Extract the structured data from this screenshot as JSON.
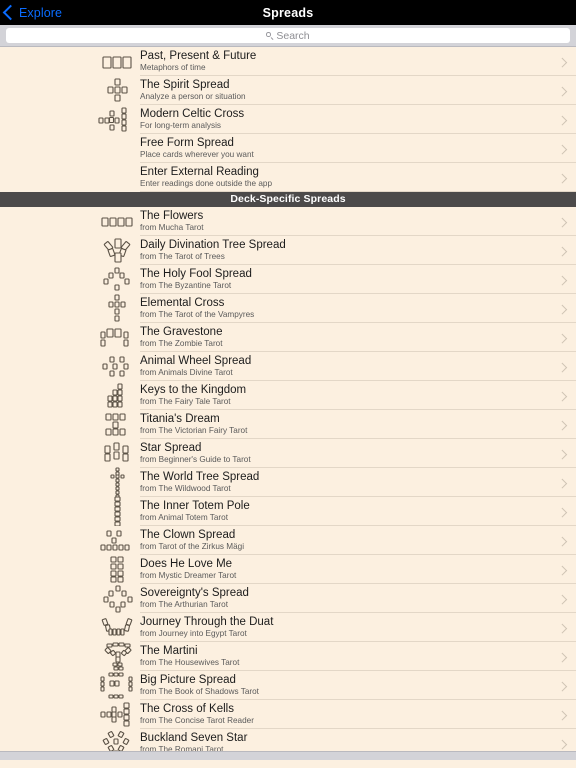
{
  "navbar": {
    "back_label": "Explore",
    "back_icon": "chevron-left-icon",
    "title": "Spreads"
  },
  "search": {
    "placeholder": "Search",
    "value": "",
    "icon": "search-icon"
  },
  "sections": [
    {
      "header": null,
      "rows": [
        {
          "title": "Past, Present & Future",
          "subtitle": "Metaphors of time",
          "icon": "three-cards-row-icon"
        },
        {
          "title": "The Spirit Spread",
          "subtitle": "Analyze a person or situation",
          "icon": "spirit-cross-icon"
        },
        {
          "title": "Modern Celtic Cross",
          "subtitle": "For long-term analysis",
          "icon": "celtic-cross-icon"
        },
        {
          "title": "Free Form Spread",
          "subtitle": "Place cards wherever you want",
          "icon": "none"
        },
        {
          "title": "Enter External Reading",
          "subtitle": "Enter readings done outside the app",
          "icon": "none"
        }
      ]
    },
    {
      "header": "Deck-Specific Spreads",
      "rows": [
        {
          "title": "The Flowers",
          "subtitle": "from Mucha Tarot",
          "icon": "four-cards-row-icon"
        },
        {
          "title": "Daily Divination Tree Spread",
          "subtitle": "from The Tarot of Trees",
          "icon": "tree-fan-icon"
        },
        {
          "title": "The Holy Fool Spread",
          "subtitle": "from The Byzantine Tarot",
          "icon": "holy-fool-icon"
        },
        {
          "title": "Elemental Cross",
          "subtitle": "from The Tarot of the Vampyres",
          "icon": "elemental-cross-icon"
        },
        {
          "title": "The Gravestone",
          "subtitle": "from The Zombie Tarot",
          "icon": "gravestone-icon"
        },
        {
          "title": "Animal Wheel Spread",
          "subtitle": "from Animals Divine Tarot",
          "icon": "animal-wheel-icon"
        },
        {
          "title": "Keys to the Kingdom",
          "subtitle": "from The Fairy Tale Tarot",
          "icon": "keys-kingdom-icon"
        },
        {
          "title": "Titania's Dream",
          "subtitle": "from The Victorian Fairy Tarot",
          "icon": "titania-dream-icon"
        },
        {
          "title": "Star Spread",
          "subtitle": "from Beginner's Guide to Tarot",
          "icon": "star-spread-icon"
        },
        {
          "title": "The World Tree Spread",
          "subtitle": "from The Wildwood Tarot",
          "icon": "world-tree-icon"
        },
        {
          "title": "The Inner Totem Pole",
          "subtitle": "from Animal Totem Tarot",
          "icon": "totem-pole-icon"
        },
        {
          "title": "The Clown Spread",
          "subtitle": "from Tarot of the Zirkus Mägi",
          "icon": "clown-icon"
        },
        {
          "title": "Does He Love Me",
          "subtitle": "from Mystic Dreamer Tarot",
          "icon": "love-me-icon"
        },
        {
          "title": "Sovereignty's Spread",
          "subtitle": "from The Arthurian Tarot",
          "icon": "sovereignty-icon"
        },
        {
          "title": "Journey Through the Duat",
          "subtitle": "from Journey into Egypt Tarot",
          "icon": "boat-icon"
        },
        {
          "title": "The Martini",
          "subtitle": "from The Housewives Tarot",
          "icon": "martini-glass-icon"
        },
        {
          "title": "Big Picture Spread",
          "subtitle": "from The Book of Shadows Tarot",
          "icon": "big-picture-icon"
        },
        {
          "title": "The Cross of Kells",
          "subtitle": "from The Concise Tarot Reader",
          "icon": "cross-of-kells-icon"
        },
        {
          "title": "Buckland Seven Star",
          "subtitle": "from The Romani Tarot",
          "icon": "buckland-seven-star-icon"
        }
      ]
    }
  ],
  "colors": {
    "background": "#fcf0e0",
    "navbar": "#000000",
    "accent": "#0a6cff",
    "section_header": "#4c4a4a",
    "divider": "#e3d7c7",
    "chevron": "#cfc4b4"
  }
}
